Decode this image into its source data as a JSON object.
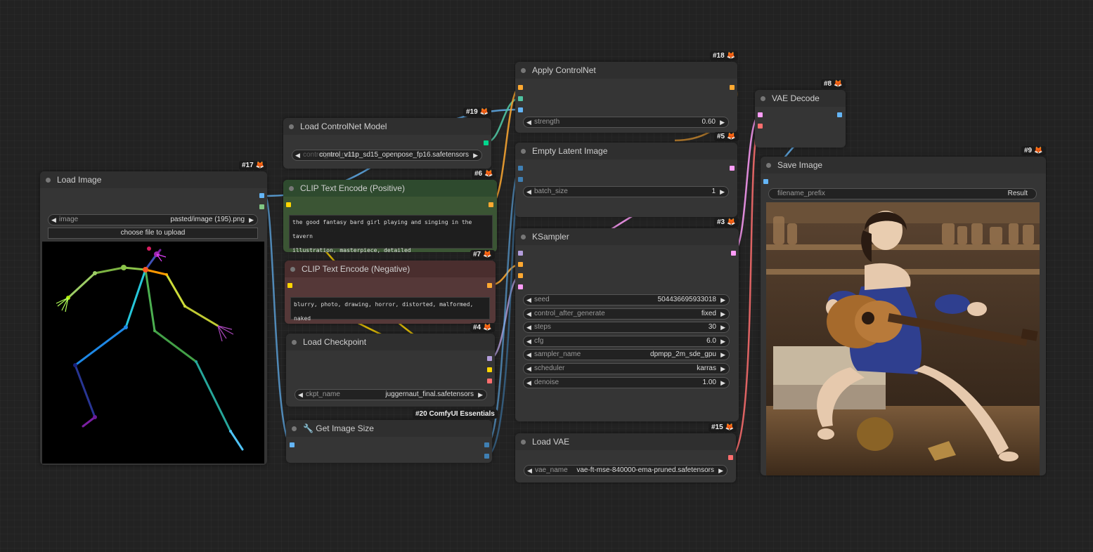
{
  "colors": {
    "background": "#222222",
    "node_bg": "#353535",
    "positive_node_bg": "#2e4a2e",
    "negative_node_bg": "#4a2e2e",
    "slot_image": "#64b5f6",
    "slot_mask": "#81c784",
    "slot_conditioning": "#ffa931",
    "slot_latent": "#ff9cf9",
    "slot_vae": "#ff6e6e",
    "slot_clip": "#ffd500",
    "slot_model": "#b39ddb",
    "slot_controlnet": "#00d78d",
    "badge_fox": "#e6882a"
  },
  "nodes": {
    "load_image": {
      "badge": "#17",
      "title": "Load Image",
      "image_label": "image",
      "image_value": "pasted/image (195).png",
      "upload_button": "choose file to upload"
    },
    "load_controlnet": {
      "badge": "#19",
      "title": "Load ControlNet Model",
      "label": "control_net_name",
      "value": "control_v11p_sd15_openpose_fp16.safetensors"
    },
    "clip_positive": {
      "badge": "#6",
      "title": "CLIP Text Encode (Positive)",
      "text": "the good fantasy bard girl playing and singing in the tavern\nillustration, masterpiece, detailed"
    },
    "clip_negative": {
      "badge": "#7",
      "title": "CLIP Text Encode (Negative)",
      "text": "blurry, photo, drawing, horror, distorted, malformed, naked"
    },
    "load_checkpoint": {
      "badge": "#4",
      "title": "Load Checkpoint",
      "label": "ckpt_name",
      "value": "juggernaut_final.safetensors"
    },
    "get_image_size": {
      "badge": "#20 ComfyUI Essentials",
      "title": "🔧 Get Image Size"
    },
    "apply_controlnet": {
      "badge": "#18",
      "title": "Apply ControlNet",
      "label": "strength",
      "value": "0.60"
    },
    "empty_latent": {
      "badge": "#5",
      "title": "Empty Latent Image",
      "label": "batch_size",
      "value": "1"
    },
    "ksampler": {
      "badge": "#3",
      "title": "KSampler",
      "widgets": [
        {
          "label": "seed",
          "value": "504436695933018"
        },
        {
          "label": "control_after_generate",
          "value": "fixed"
        },
        {
          "label": "steps",
          "value": "30"
        },
        {
          "label": "cfg",
          "value": "6.0"
        },
        {
          "label": "sampler_name",
          "value": "dpmpp_2m_sde_gpu"
        },
        {
          "label": "scheduler",
          "value": "karras"
        },
        {
          "label": "denoise",
          "value": "1.00"
        }
      ]
    },
    "load_vae": {
      "badge": "#15",
      "title": "Load VAE",
      "label": "vae_name",
      "value": "vae-ft-mse-840000-ema-pruned.safetensors"
    },
    "vae_decode": {
      "badge": "#8",
      "title": "VAE Decode"
    },
    "save_image": {
      "badge": "#9",
      "title": "Save Image",
      "label": "filename_prefix",
      "value": "Result"
    }
  },
  "icons": {
    "arrow_left": "◀",
    "arrow_right": "▶",
    "fox": "🦊"
  }
}
